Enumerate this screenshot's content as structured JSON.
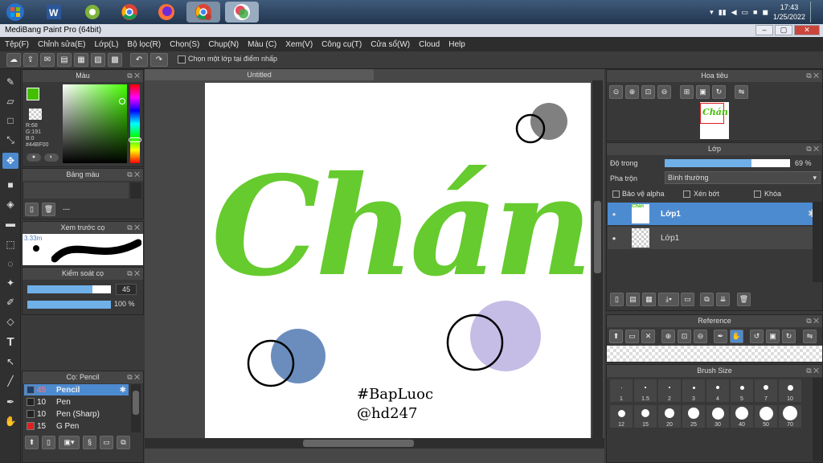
{
  "taskbar": {
    "time": "17:43",
    "date": "1/25/2022",
    "apps": [
      "windows-start",
      "word",
      "greenshot",
      "chrome",
      "firefox",
      "chrome-b",
      "medibang"
    ]
  },
  "window": {
    "title": "MediBang Paint Pro (64bit)"
  },
  "menu": [
    "Tệp(F)",
    "Chỉnh sửa(E)",
    "Lớp(L)",
    "Bộ lọc(R)",
    "Chọn(S)",
    "Chụp(N)",
    "Màu (C)",
    "Xem(V)",
    "Công cụ(T)",
    "Cửa sổ(W)",
    "Cloud",
    "Help"
  ],
  "toolbar": {
    "checkbox_label": "Chọn một lớp tại điểm nhấp"
  },
  "color_panel": {
    "title": "Màu",
    "r": "R:68",
    "g": "G:191",
    "b": "B:0",
    "hex": "#44BF00",
    "primary": "#44BF00"
  },
  "palette_panel": {
    "title": "Bảng màu",
    "value": "---"
  },
  "brush_preview": {
    "title": "Xem trước cọ",
    "size": "3.33m"
  },
  "brush_control": {
    "title": "Kiểm soát cọ",
    "size_value": "45",
    "size_fraction": 0.78,
    "opacity_value": "100 %",
    "opacity_fraction": 1.0
  },
  "brush_list": {
    "title": "Cọ: Pencil",
    "items": [
      {
        "size": "45",
        "name": "Pencil",
        "color": "#1d3e6b"
      },
      {
        "size": "10",
        "name": "Pen",
        "color": "#222222"
      },
      {
        "size": "10",
        "name": "Pen (Sharp)",
        "color": "#222222"
      },
      {
        "size": "15",
        "name": "G Pen",
        "color": "#e02020"
      }
    ]
  },
  "document": {
    "tab": "Untitled",
    "art_text": "Chán",
    "hashtag": "#BapLuoc",
    "handle": "@hd247"
  },
  "navigator": {
    "title": "Hoa tiêu",
    "thumb_text": "Chán"
  },
  "layer_panel": {
    "title": "Lớp",
    "opacity_label": "Độ trong",
    "opacity_value": "69 %",
    "opacity_fraction": 0.69,
    "blend_label": "Pha trộn",
    "blend_value": "Bình thường",
    "protect_alpha": "Bảo vệ alpha",
    "clipping": "Xén bớt",
    "lock": "Khóa",
    "layers": [
      {
        "name": "Lớp1",
        "selected": true
      },
      {
        "name": "Lớp1",
        "selected": false
      }
    ]
  },
  "reference_panel": {
    "title": "Reference"
  },
  "brush_size_panel": {
    "title": "Brush Size",
    "row1": [
      "1",
      "1.5",
      "2",
      "3",
      "4",
      "5",
      "7",
      "10"
    ],
    "row2": [
      "12",
      "15",
      "20",
      "25",
      "30",
      "40",
      "50",
      "70"
    ]
  }
}
